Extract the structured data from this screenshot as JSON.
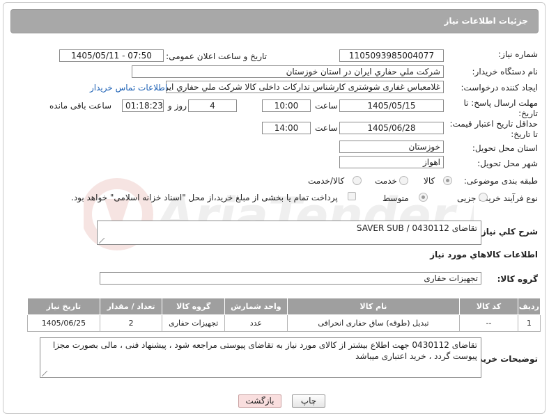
{
  "page_title": "جزئیات اطلاعات نیاز",
  "fields": {
    "need_number_label": "شماره نیاز:",
    "need_number": "1105093985004077",
    "announce_label": "تاریخ و ساعت اعلان عمومی:",
    "announce_value": "1405/05/11 - 07:50",
    "buyer_org_label": "نام دستگاه خریدار:",
    "buyer_org": "شرکت ملي حفاري ايران در استان خوزستان",
    "creator_label": "ایجاد کننده درخواست:",
    "creator": "غلامعباس غفاری شوشتری کارشناس تدارکات داخلی کالا شرکت ملي حفاري ايران",
    "contact_link": "اطلاعات تماس خریدار",
    "deadline_label_1": "مهلت ارسال پاسخ: تا",
    "deadline_label_2": "تاریخ:",
    "deadline_date": "1405/05/15",
    "time_label": "ساعت",
    "deadline_time": "10:00",
    "days_value": "4",
    "days_label": "روز و",
    "remaining_value": "01:18:23",
    "remaining_label": "ساعت باقی مانده",
    "validity_label_1": "حداقل تاریخ اعتبار قیمت:",
    "validity_label_2": "تا تاریخ:",
    "validity_date": "1405/06/28",
    "validity_time": "14:00",
    "province_label": "استان محل تحویل:",
    "province": "خوزستان",
    "city_label": "شهر محل تحویل:",
    "city": "اهواز",
    "category_label": "طبقه بندی موضوعی:",
    "category_options": [
      "کالا",
      "خدمت",
      "کالا/خدمت"
    ],
    "process_label": "نوع فرآیند خرید :",
    "process_options": [
      "جزیی",
      "متوسط"
    ],
    "payment_note": "پرداخت تمام یا بخشی از مبلغ خرید،از محل \"اسناد خزانه اسلامی\" خواهد بود."
  },
  "general_desc": {
    "label": "شرح کلي نیاز:",
    "value": "تقاضای SAVER SUB / 0430112"
  },
  "goods_info_title": "اطلاعات کالاهاي مورد نیاز",
  "goods_group": {
    "label": "گروه کالا:",
    "value": "تجهیزات حفاری"
  },
  "table": {
    "headers": [
      "ردیف",
      "کد کالا",
      "نام کالا",
      "واحد شمارش",
      "گروه کالا",
      "تعداد / مقدار",
      "تاریخ نیاز"
    ],
    "rows": [
      [
        "1",
        "--",
        "تبدیل (طوقه) ساق حفاری انحرافی",
        "عدد",
        "تجهیزات حفاری",
        "2",
        "1405/06/25"
      ]
    ]
  },
  "buyer_notes": {
    "label": "توضیحات خریدار:",
    "value": "تقاضای 0430112 جهت اطلاع بیشتر از کالای مورد نیاز به تقاضای پیوستی مراجعه شود ، پیشنهاد فنی ، مالی بصورت مجزا پیوست گردد ، خرید اعتباری میباشد"
  },
  "buttons": {
    "print": "چاپ",
    "back": "بازگشت"
  },
  "watermark_text": "AriaTender.net",
  "colors": {
    "header_bg": "#a8a8a8",
    "table_header_bg": "#9f9f9f",
    "link": "#1a5fb4",
    "back_button_bg": "#f9dede"
  }
}
